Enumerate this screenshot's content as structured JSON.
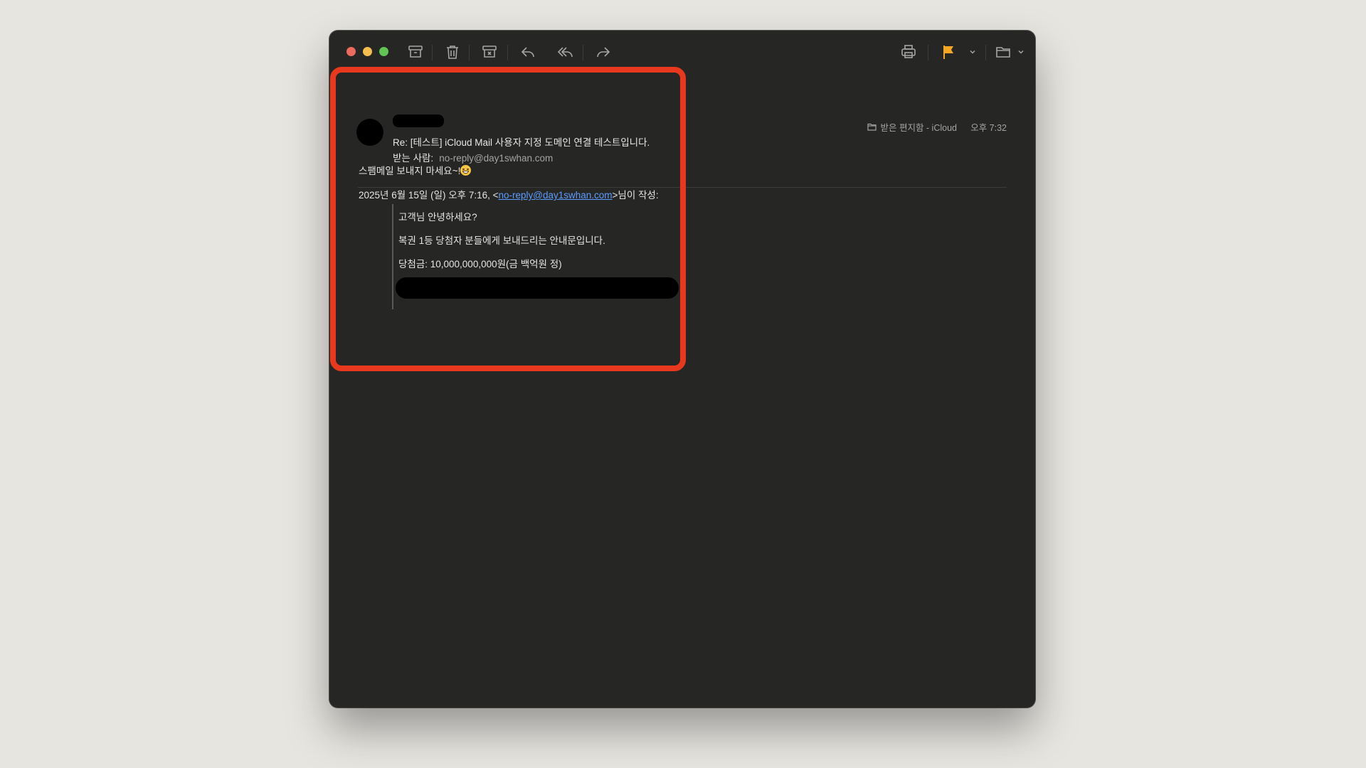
{
  "toolbar": {
    "buttons": [
      {
        "icon": "archive-icon"
      },
      {
        "icon": "trash-icon"
      },
      {
        "icon": "junk-icon"
      },
      {
        "icon": "reply-icon"
      },
      {
        "icon": "reply-all-icon"
      },
      {
        "icon": "forward-icon"
      },
      {
        "icon": "print-icon"
      },
      {
        "icon": "flag-icon"
      },
      {
        "icon": "move-to-folder-icon"
      }
    ],
    "flag_color": "#f5a623"
  },
  "message": {
    "subject": "Re: [테스트] iCloud Mail 사용자 지정 도메인 연결 테스트입니다.",
    "to_label": "받는 사람:",
    "to_address": "no-reply@day1swhan.com",
    "mailbox": "받은 편지함 - iCloud",
    "time": "오후 7:32"
  },
  "body": {
    "line1": "스팸메일 보내지 마세요~!",
    "quote_header_prefix": "2025년 6월 15일 (일) 오후 7:16, <",
    "quote_header_link": "no-reply@day1swhan.com",
    "quote_header_suffix": ">님이 작성:",
    "quoted_lines": [
      "고객님 안녕하세요?",
      "복권 1등 당첨자 분들에게 보내드리는 안내문입니다.",
      "당첨금: 10,000,000,000원(금 백억원 정)"
    ]
  },
  "colors": {
    "highlight": "#e8391f",
    "link": "#5b9dff"
  }
}
